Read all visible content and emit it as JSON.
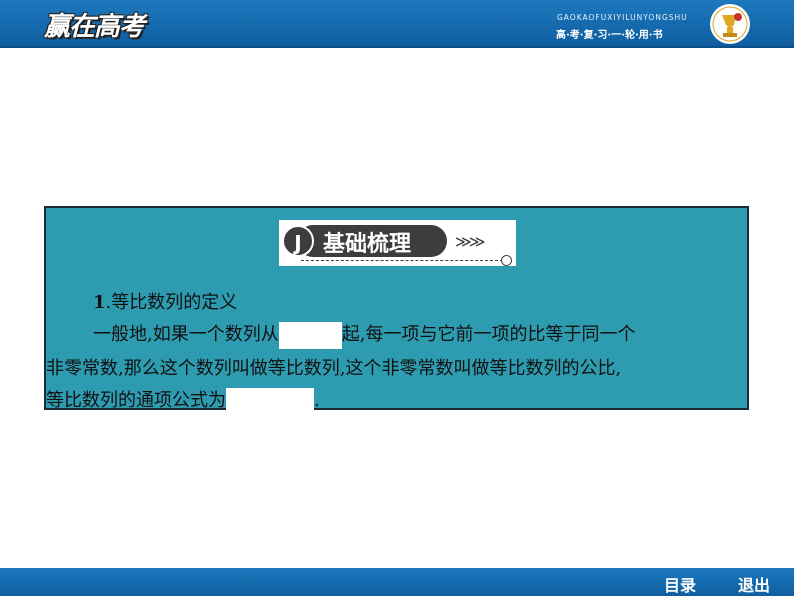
{
  "header": {
    "logo": "赢在高考",
    "pinyin": "GAOKAOFUXIYILUNYONGSHU",
    "book_title": "高·考·复·习·一·轮·用·书"
  },
  "section": {
    "badge_letter": "J",
    "badge_title": "基础梳理",
    "badge_arrows": "≫≫"
  },
  "content": {
    "heading_num": "1",
    "heading_text": ".等比数列的定义",
    "line1_before": "一般地,如果一个数列从",
    "line1_after": "起,每一项与它前一项的比等于同一个",
    "line2": "非零常数,那么这个数列叫做等比数列,这个非零常数叫做等比数列的公比,",
    "line3_before": "等比数列的通项公式为",
    "line3_after": "."
  },
  "footer": {
    "toc_label": "目录",
    "exit_label": "退出"
  }
}
